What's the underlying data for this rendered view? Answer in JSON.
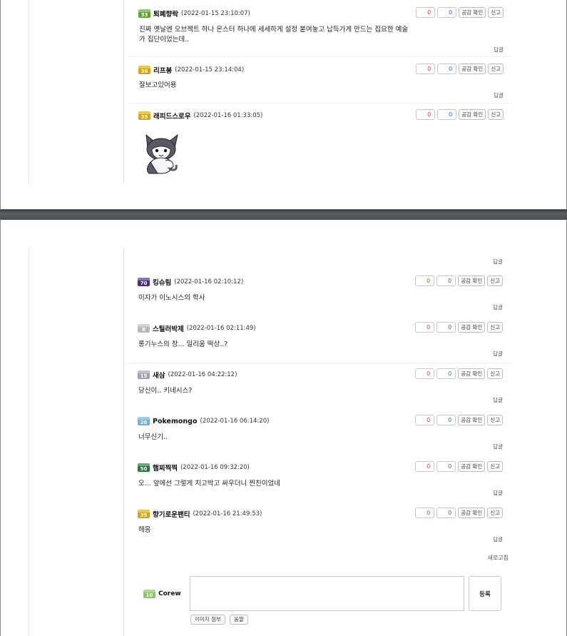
{
  "comments_top": [
    {
      "level": "33",
      "level_color": "#5aa62d",
      "nick": "퇴폐향락",
      "date": "(2022-01-15 23:10:07)",
      "text": "진짜 옛날엔 오브젝트 하나 몬스터 하나에 세세하게 설정 붙여놓고 납득가게 만드는 집요한 예술가 집단이었는데..",
      "likes": "0",
      "dislikes": "0",
      "reply": "답글"
    },
    {
      "level": "36",
      "level_color": "#d4a516",
      "nick": "리프봉",
      "date": "(2022-01-15 23:14:04)",
      "text": "잘보고있어용",
      "likes": "0",
      "dislikes": "0",
      "reply": "답글"
    },
    {
      "level": "39",
      "level_color": "#d4a516",
      "nick": "래피드스로우",
      "date": "(2022-01-16 01:33:05)",
      "text": "",
      "likes": "0",
      "dislikes": "0"
    }
  ],
  "comments_bottom": [
    {
      "level": "70",
      "level_color": "#4b2a8c",
      "nick": "킹슈림",
      "date": "(2022-01-16 02:10:12)",
      "text": "이자가 이노시스의 학사",
      "likes": "0",
      "dislikes": "0",
      "reply": "답글"
    },
    {
      "level": "8",
      "level_color": "#b9b9b9",
      "nick": "스틸러박제",
      "date": "(2022-01-16 02:11:49)",
      "text": "롱기누스의 창... 일리움 떡상..?",
      "likes": "0",
      "dislikes": "0",
      "reply": "답글"
    },
    {
      "level": "15",
      "level_color": "#9aa3b8",
      "nick": "새삼",
      "date": "(2022-01-16 04:22:12)",
      "text": "당신이.. 키네시스?",
      "likes": "0",
      "dislikes": "0",
      "reply": "답글"
    },
    {
      "level": "20",
      "level_color": "#6fb0d8",
      "nick": "Pokemongo",
      "date": "(2022-01-16 06:14:20)",
      "text": "너무신기..",
      "likes": "0",
      "dislikes": "0",
      "reply": "답글"
    },
    {
      "level": "50",
      "level_color": "#1f7a3a",
      "nick": "햄찌찍찍",
      "date": "(2022-01-16 09:32:20)",
      "text": "오... 앞에선 그렇게 치고박고 싸우더니 찐친이었네",
      "likes": "0",
      "dislikes": "0",
      "reply": "답글"
    },
    {
      "level": "35",
      "level_color": "#d4a516",
      "nick": "향기로운팬티",
      "date": "(2022-01-16 21:49:53)",
      "text": "헤응",
      "likes": "0",
      "dislikes": "0",
      "reply": "답글"
    }
  ],
  "buttons": {
    "like_check": "공감 확인",
    "report": "신고"
  },
  "top_reply_bottom_page": "답글",
  "refresh": "새로고침",
  "writer": {
    "level": "10",
    "level_color": "#8cc26a",
    "nick": "Corew"
  },
  "comment_input": {
    "placeholder": "",
    "value": ""
  },
  "submit_label": "등록",
  "tools": {
    "attach_image": "이미지 첨부",
    "emoticon": "움짤"
  }
}
